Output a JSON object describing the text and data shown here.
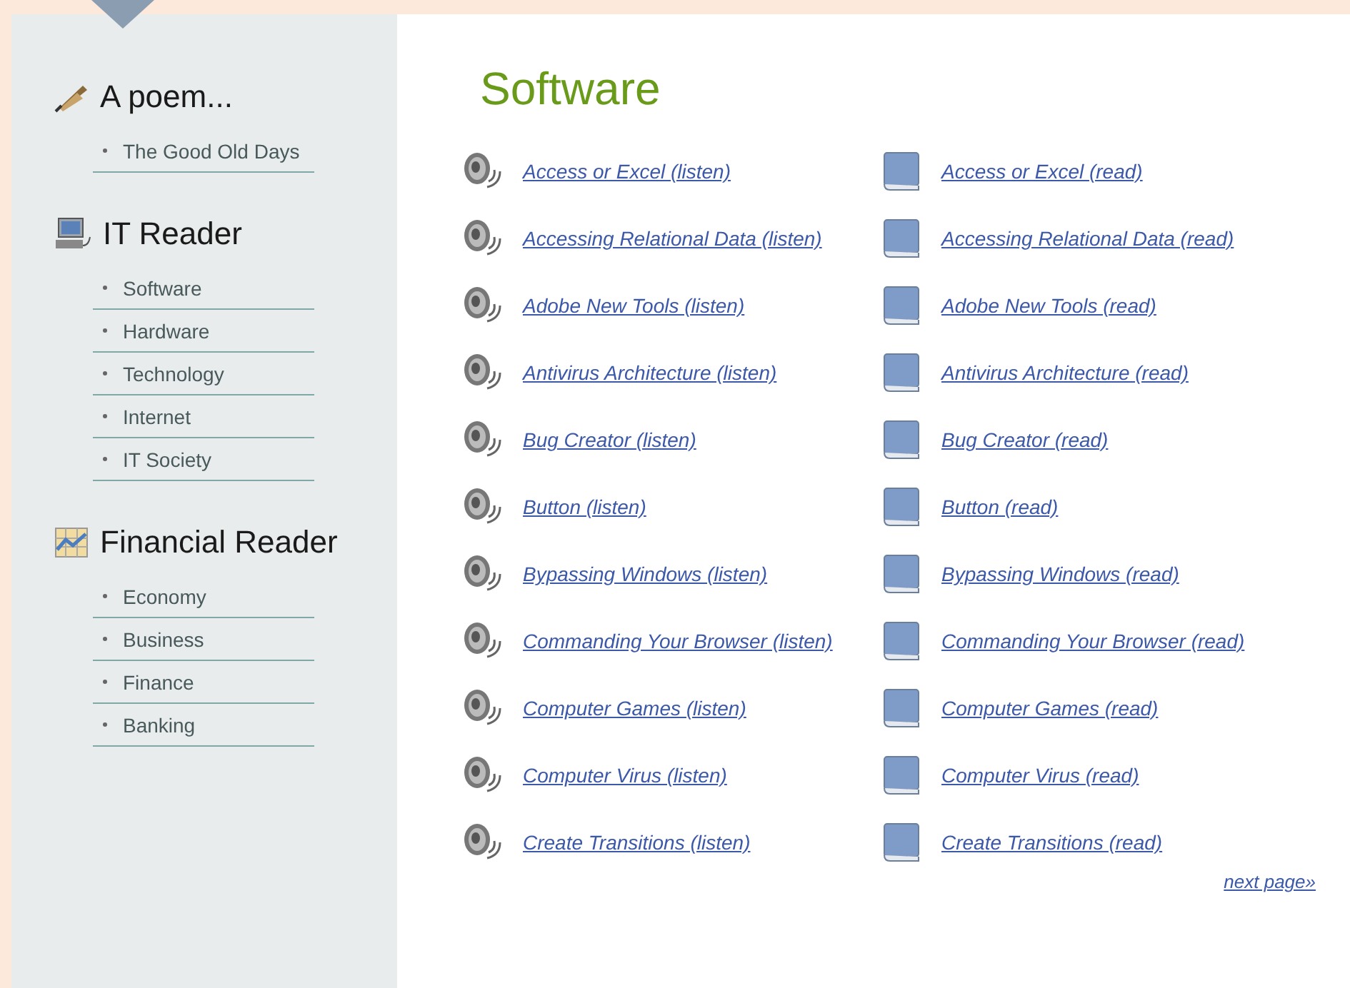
{
  "sidebar": {
    "sections": [
      {
        "kind": "poem",
        "title": "A poem...",
        "items": [
          "The Good Old Days"
        ]
      },
      {
        "kind": "computer",
        "title": "IT Reader",
        "items": [
          "Software",
          "Hardware",
          "Technology",
          "Internet",
          "IT Society"
        ]
      },
      {
        "kind": "chart",
        "title": "Financial Reader",
        "items": [
          "Economy",
          "Business",
          "Finance",
          "Banking"
        ]
      }
    ]
  },
  "main": {
    "title": "Software",
    "rows": [
      {
        "listen": "Access or Excel (listen)",
        "read": "Access or Excel (read)"
      },
      {
        "listen": "Accessing Relational Data (listen)",
        "read": "Accessing Relational Data (read)"
      },
      {
        "listen": "Adobe New Tools (listen)",
        "read": "Adobe New Tools (read)"
      },
      {
        "listen": "Antivirus Architecture (listen)",
        "read": "Antivirus Architecture (read)"
      },
      {
        "listen": "Bug Creator (listen)",
        "read": "Bug Creator (read)"
      },
      {
        "listen": "Button (listen)",
        "read": "Button (read)"
      },
      {
        "listen": "Bypassing Windows (listen)",
        "read": "Bypassing Windows (read)"
      },
      {
        "listen": "Commanding Your Browser (listen)",
        "read": "Commanding Your Browser (read)"
      },
      {
        "listen": "Computer Games (listen)",
        "read": "Computer Games (read)"
      },
      {
        "listen": "Computer Virus (listen)",
        "read": "Computer Virus (read)"
      },
      {
        "listen": "Create Transitions (listen)",
        "read": "Create Transitions (read)"
      }
    ],
    "next": "next page»"
  }
}
